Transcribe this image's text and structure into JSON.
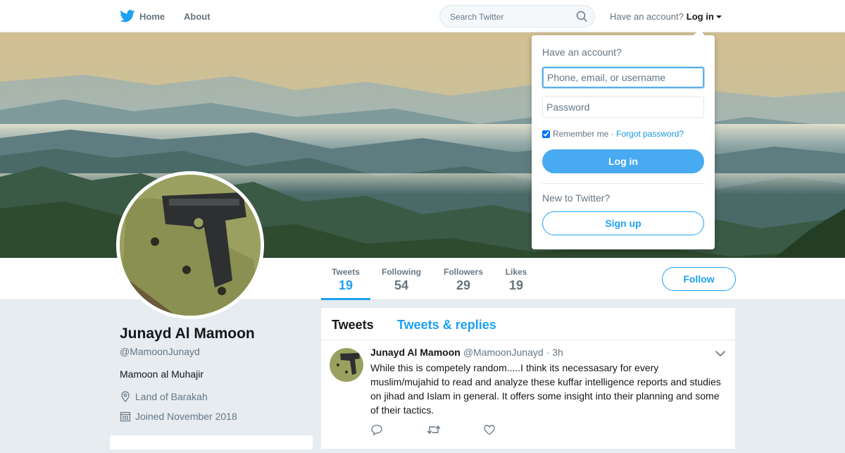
{
  "nav": {
    "home_label": "Home",
    "about_label": "About",
    "search_placeholder": "Search Twitter",
    "have_account": "Have an account?",
    "login_label": "Log in"
  },
  "colors": {
    "accent": "#1da1f2",
    "login_button": "#48aaf0",
    "page_bg": "#e6ecf0"
  },
  "profile": {
    "name": "Junayd Al Mamoon",
    "handle": "@MamoonJunayd",
    "bio": "Mamoon al Muhajir",
    "location": "Land of Barakah",
    "joined": "Joined November 2018",
    "follow_label": "Follow",
    "stats": [
      {
        "label": "Tweets",
        "value": "19"
      },
      {
        "label": "Following",
        "value": "54"
      },
      {
        "label": "Followers",
        "value": "29"
      },
      {
        "label": "Likes",
        "value": "19"
      }
    ]
  },
  "timeline": {
    "tabs": [
      "Tweets",
      "Tweets & replies"
    ],
    "tweet": {
      "name": "Junayd Al Mamoon",
      "handle": "@MamoonJunayd",
      "time": "· 3h",
      "text": "While this is competely random.....I think its necessasary for every muslim/mujahid to read and analyze these kuffar intelligence reports and studies on jihad and Islam in general. It offers some insight into their planning and some of their tactics."
    }
  },
  "login_dropdown": {
    "title": "Have an account?",
    "username_placeholder": "Phone, email, or username",
    "password_placeholder": "Password",
    "remember_label": "Remember me",
    "separator": " · ",
    "forgot_label": "Forgot password?",
    "login_button": "Log in",
    "new_label": "New to Twitter?",
    "signup_button": "Sign up"
  }
}
